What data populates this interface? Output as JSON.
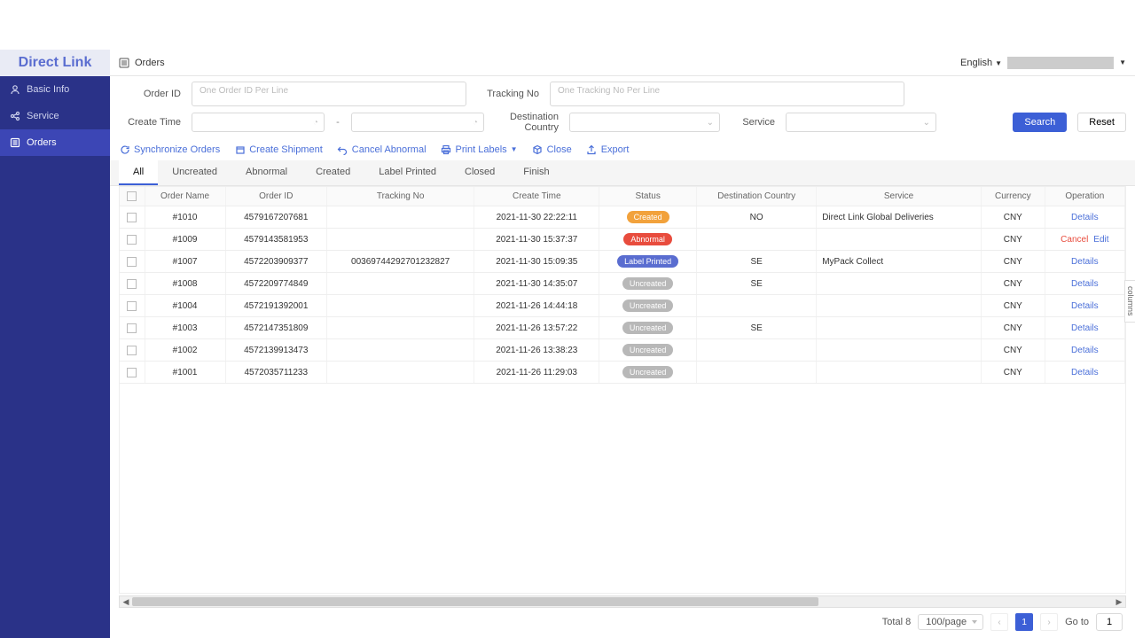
{
  "brand": "Direct Link",
  "sidebar": {
    "items": [
      {
        "label": "Basic Info",
        "icon": "user-icon",
        "active": false
      },
      {
        "label": "Service",
        "icon": "share-icon",
        "active": false
      },
      {
        "label": "Orders",
        "icon": "list-icon",
        "active": true
      }
    ]
  },
  "breadcrumb": {
    "icon": "list-icon",
    "title": "Orders"
  },
  "language": "English",
  "filters": {
    "order_id_label": "Order ID",
    "order_id_placeholder": "One Order ID Per Line",
    "tracking_label": "Tracking No",
    "tracking_placeholder": "One Tracking No Per Line",
    "create_time_label": "Create Time",
    "destination_label": "Destination Country",
    "service_label": "Service",
    "search_btn": "Search",
    "reset_btn": "Reset"
  },
  "actions": {
    "sync": "Synchronize Orders",
    "create_shipment": "Create Shipment",
    "cancel_abnormal": "Cancel Abnormal",
    "print_labels": "Print Labels",
    "close": "Close",
    "export": "Export"
  },
  "tabs": [
    "All",
    "Uncreated",
    "Abnormal",
    "Created",
    "Label Printed",
    "Closed",
    "Finish"
  ],
  "active_tab": 0,
  "columns": [
    "",
    "Order Name",
    "Order ID",
    "Tracking No",
    "Create Time",
    "Status",
    "Destination Country",
    "Service",
    "Currency",
    "Operation"
  ],
  "status_labels": {
    "created": "Created",
    "abnormal": "Abnormal",
    "label_printed": "Label Printed",
    "uncreated": "Uncreated"
  },
  "op_labels": {
    "details": "Details",
    "cancel": "Cancel",
    "edit": "Edit"
  },
  "rows": [
    {
      "name": "#1010",
      "order_id": "4579167207681",
      "tracking": "",
      "create_time": "2021-11-30 22:22:11",
      "status": "created",
      "country": "NO",
      "service": "Direct Link Global Deliveries",
      "currency": "CNY",
      "ops": [
        "details"
      ]
    },
    {
      "name": "#1009",
      "order_id": "4579143581953",
      "tracking": "",
      "create_time": "2021-11-30 15:37:37",
      "status": "abnormal",
      "country": "",
      "service": "",
      "currency": "CNY",
      "ops": [
        "cancel",
        "edit"
      ]
    },
    {
      "name": "#1007",
      "order_id": "4572203909377",
      "tracking": "00369744292701232827",
      "create_time": "2021-11-30 15:09:35",
      "status": "label_printed",
      "country": "SE",
      "service": "MyPack Collect",
      "currency": "CNY",
      "ops": [
        "details"
      ]
    },
    {
      "name": "#1008",
      "order_id": "4572209774849",
      "tracking": "",
      "create_time": "2021-11-30 14:35:07",
      "status": "uncreated",
      "country": "SE",
      "service": "",
      "currency": "CNY",
      "ops": [
        "details"
      ]
    },
    {
      "name": "#1004",
      "order_id": "4572191392001",
      "tracking": "",
      "create_time": "2021-11-26 14:44:18",
      "status": "uncreated",
      "country": "",
      "service": "",
      "currency": "CNY",
      "ops": [
        "details"
      ]
    },
    {
      "name": "#1003",
      "order_id": "4572147351809",
      "tracking": "",
      "create_time": "2021-11-26 13:57:22",
      "status": "uncreated",
      "country": "SE",
      "service": "",
      "currency": "CNY",
      "ops": [
        "details"
      ]
    },
    {
      "name": "#1002",
      "order_id": "4572139913473",
      "tracking": "",
      "create_time": "2021-11-26 13:38:23",
      "status": "uncreated",
      "country": "",
      "service": "",
      "currency": "CNY",
      "ops": [
        "details"
      ]
    },
    {
      "name": "#1001",
      "order_id": "4572035711233",
      "tracking": "",
      "create_time": "2021-11-26 11:29:03",
      "status": "uncreated",
      "country": "",
      "service": "",
      "currency": "CNY",
      "ops": [
        "details"
      ]
    }
  ],
  "columns_side": "columns",
  "pager": {
    "total_label": "Total 8",
    "per_page": "100/page",
    "current": "1",
    "goto_label": "Go to",
    "goto_value": "1"
  }
}
